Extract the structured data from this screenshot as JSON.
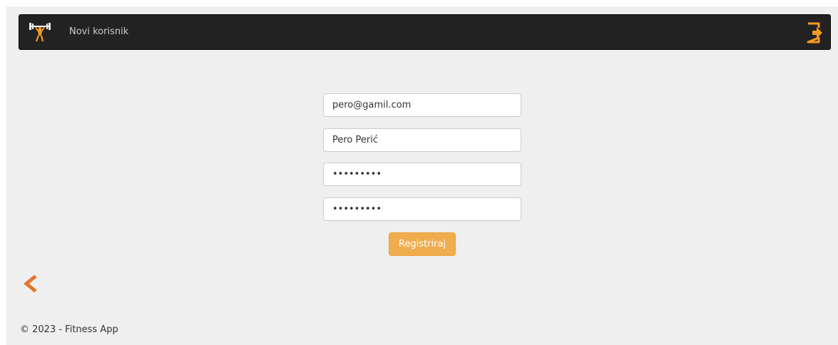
{
  "navbar": {
    "title": "Novi korisnik",
    "logo_icon": "weightlifter-icon",
    "logout_icon": "sign-out-icon"
  },
  "form": {
    "email_value": "pero@gamil.com",
    "name_value": "Pero Perić",
    "password_value": "123456789",
    "confirm_password_value": "123456789",
    "submit_label": "Registriraj"
  },
  "back_icon": "chevron-left-icon",
  "footer": {
    "text": "© 2023 - Fitness App"
  },
  "colors": {
    "navbar_bg": "#222222",
    "accent_orange": "#f0ad4e",
    "icon_orange": "#f59a23",
    "back_arrow": "#e5762a",
    "page_bg": "#efefef"
  }
}
